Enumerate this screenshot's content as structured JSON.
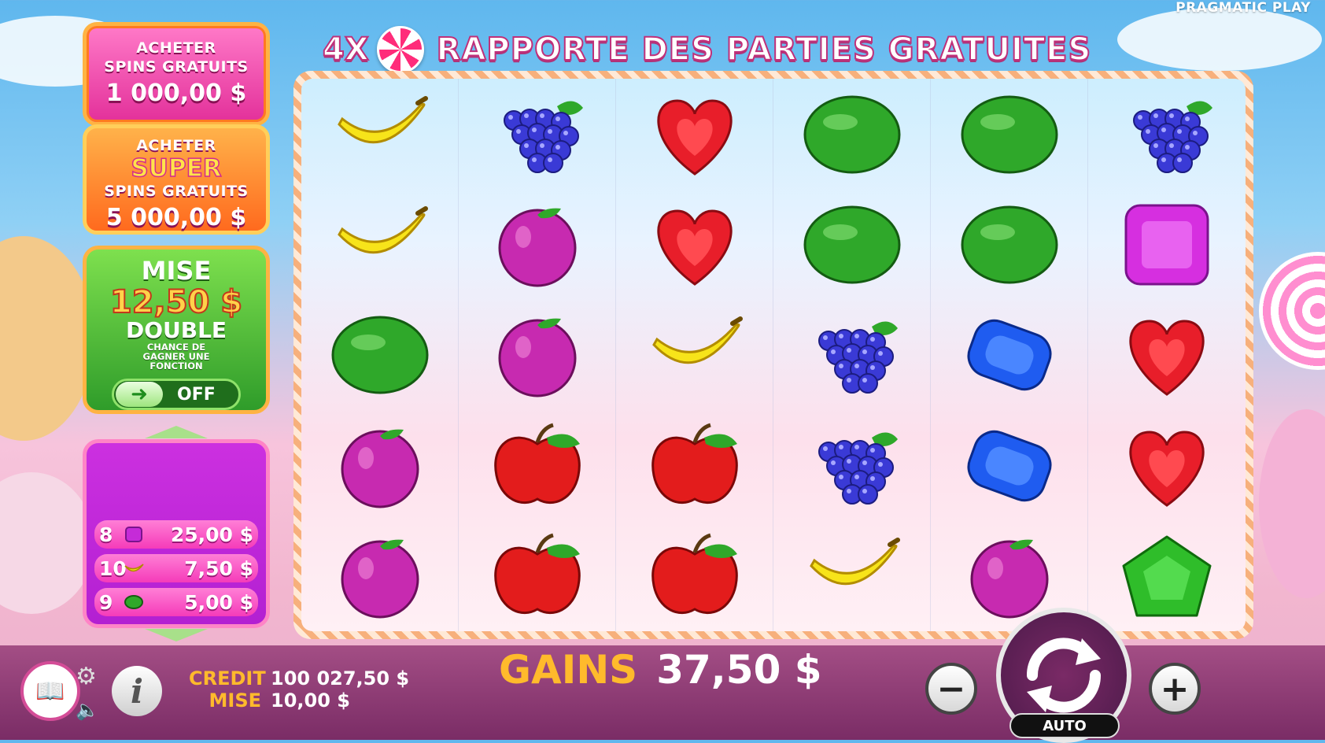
{
  "brand": "PRAGMATIC PLAY",
  "banner": {
    "multiplier": "4X",
    "text": "RAPPORTE DES PARTIES GRATUITES"
  },
  "buy_free_spins": {
    "line1": "ACHETER",
    "line2": "SPINS GRATUITS",
    "price": "1 000,00 $"
  },
  "buy_super_spins": {
    "line1": "ACHETER",
    "line2": "SUPER",
    "line3": "SPINS GRATUITS",
    "price": "5 000,00 $"
  },
  "ante_bet": {
    "title": "MISE",
    "amount": "12,50 $",
    "double": "DOUBLE",
    "desc": "CHANCE DE GAGNER UNE FONCTION",
    "toggle_state": "OFF"
  },
  "wins": [
    {
      "count": "8",
      "symbol": "purple-candy",
      "amount": "25,00 $"
    },
    {
      "count": "10",
      "symbol": "banana",
      "amount": "7,50 $"
    },
    {
      "count": "9",
      "symbol": "watermelon",
      "amount": "5,00 $"
    }
  ],
  "grid": [
    [
      "banana",
      "grapes",
      "red-heart",
      "watermelon",
      "watermelon",
      "grapes"
    ],
    [
      "banana",
      "plum",
      "red-heart",
      "watermelon",
      "watermelon",
      "purple-candy"
    ],
    [
      "watermelon",
      "plum",
      "banana",
      "grapes",
      "blue-candy",
      "red-heart"
    ],
    [
      "plum",
      "apple",
      "apple",
      "grapes",
      "blue-candy",
      "red-heart"
    ],
    [
      "plum",
      "apple",
      "apple",
      "banana",
      "plum",
      "green-candy"
    ]
  ],
  "footer": {
    "credit_label": "CREDIT",
    "credit_value": "100 027,50 $",
    "bet_label": "MISE",
    "bet_value": "10,00 $",
    "win_label": "GAINS",
    "win_value": "37,50 $",
    "auto_label": "AUTO"
  },
  "colors": {
    "accent_pink": "#e3309a",
    "accent_orange": "#ff6a1e",
    "accent_green": "#2f9c2a",
    "gold": "#ffba2c"
  }
}
